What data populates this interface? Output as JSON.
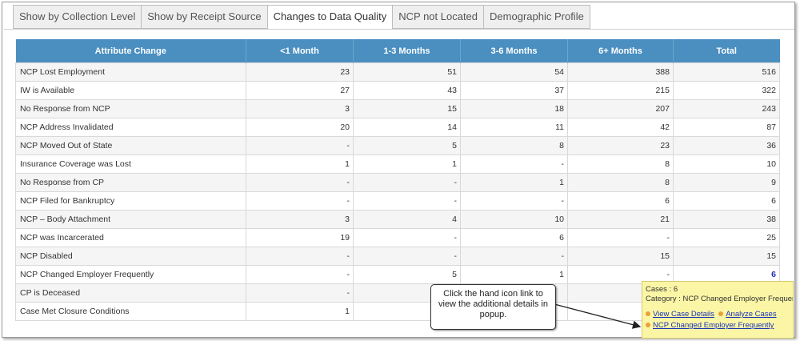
{
  "tabs": [
    {
      "label": "Show by Collection Level",
      "active": false
    },
    {
      "label": "Show by Receipt Source",
      "active": false
    },
    {
      "label": "Changes to Data Quality",
      "active": true
    },
    {
      "label": "NCP not Located",
      "active": false
    },
    {
      "label": "Demographic Profile",
      "active": false
    }
  ],
  "table": {
    "headers": [
      "Attribute Change",
      "<1 Month",
      "1-3 Months",
      "3-6 Months",
      "6+ Months",
      "Total"
    ],
    "rows": [
      [
        "NCP Lost Employment",
        "23",
        "51",
        "54",
        "388",
        "516"
      ],
      [
        "IW is Available",
        "27",
        "43",
        "37",
        "215",
        "322"
      ],
      [
        "No Response from NCP",
        "3",
        "15",
        "18",
        "207",
        "243"
      ],
      [
        "NCP Address Invalidated",
        "20",
        "14",
        "11",
        "42",
        "87"
      ],
      [
        "NCP Moved Out of State",
        "-",
        "5",
        "8",
        "23",
        "36"
      ],
      [
        "Insurance Coverage was Lost",
        "1",
        "1",
        "-",
        "8",
        "10"
      ],
      [
        "No Response from CP",
        "-",
        "-",
        "1",
        "8",
        "9"
      ],
      [
        "NCP Filed for Bankruptcy",
        "-",
        "-",
        "-",
        "6",
        "6"
      ],
      [
        "NCP – Body Attachment",
        "3",
        "4",
        "10",
        "21",
        "38"
      ],
      [
        "NCP was Incarcerated",
        "19",
        "-",
        "6",
        "-",
        "25"
      ],
      [
        "NCP Disabled",
        "-",
        "-",
        "-",
        "15",
        "15"
      ],
      [
        "NCP Changed Employer Frequently",
        "-",
        "5",
        "1",
        "-",
        "6"
      ],
      [
        "CP is Deceased",
        "-",
        "",
        "",
        "",
        ""
      ],
      [
        "Case Met Closure Conditions",
        "1",
        "",
        "",
        "",
        ""
      ]
    ]
  },
  "popup": {
    "cases": "Cases : 6",
    "category": "Category : NCP Changed Employer Frequently",
    "link_view": "View Case Details",
    "link_analyze": "Analyze Cases",
    "link_category": "NCP Changed Employer Frequently"
  },
  "callout": {
    "text": "Click the hand icon  link to view the additional details in popup."
  },
  "colors": {
    "header_bg": "#4a8fc0",
    "popup_bg": "#fbf6a6",
    "link": "#1a33b3"
  }
}
